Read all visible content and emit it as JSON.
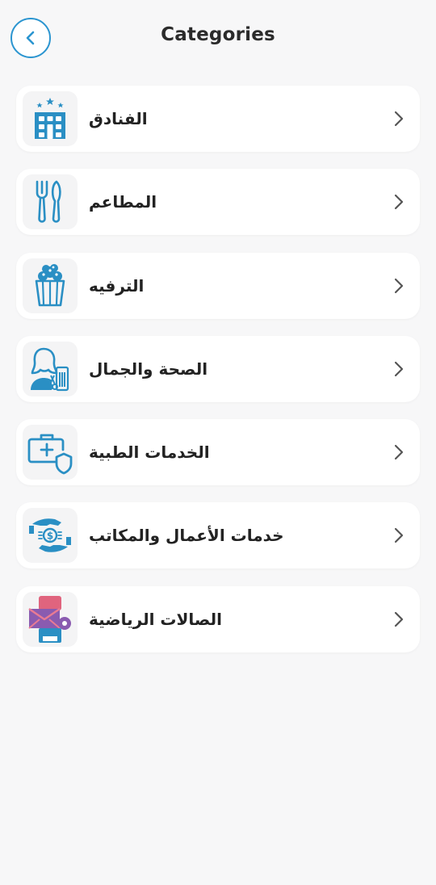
{
  "header": {
    "title": "Categories",
    "back_icon": "chevron-left-icon"
  },
  "colors": {
    "accent": "#2b95d0",
    "background": "#f7f7f8",
    "card": "#ffffff"
  },
  "categories": [
    {
      "label": "الفنادق",
      "icon": "hotel-icon"
    },
    {
      "label": "المطاعم",
      "icon": "fork-knife-icon"
    },
    {
      "label": "الترفيه",
      "icon": "popcorn-icon"
    },
    {
      "label": "الصحة والجمال",
      "icon": "beauty-salon-icon"
    },
    {
      "label": "الخدمات الطبية",
      "icon": "medical-kit-icon"
    },
    {
      "label": "خدمات الأعمال والمكاتب",
      "icon": "business-services-icon"
    },
    {
      "label": "الصالات الرياضية",
      "icon": "gym-mail-icon"
    }
  ]
}
